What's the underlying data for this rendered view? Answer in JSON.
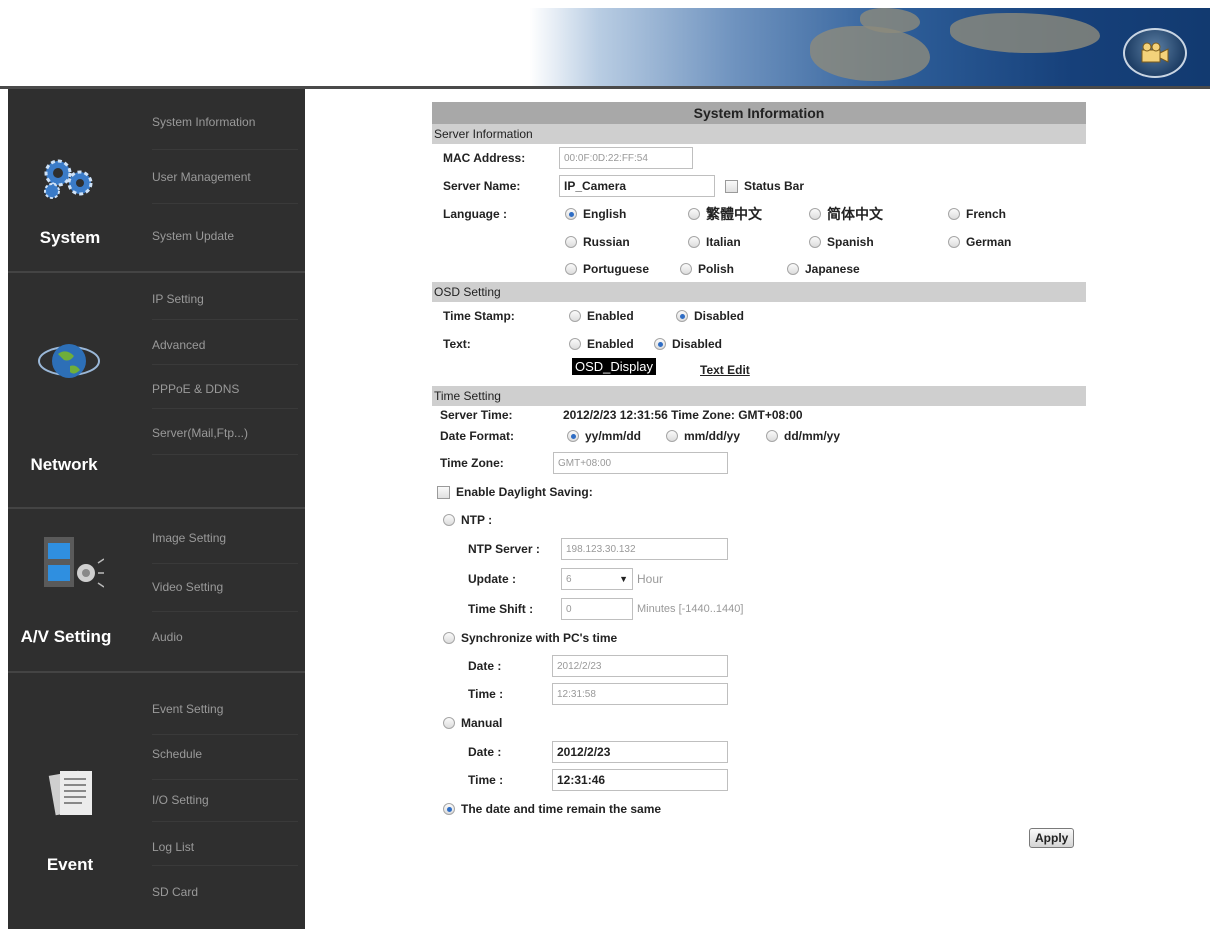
{
  "colors": {
    "sidebar_bg": "#2f2f2f",
    "title_bar": "#a8a8a8",
    "section_bar": "#cfcfcf",
    "radio_selected": "#2f6dc4"
  },
  "sidebar": {
    "sections": [
      {
        "label": "System",
        "icon": "gears-icon",
        "items": [
          "System Information",
          "User Management",
          "System Update"
        ]
      },
      {
        "label": "Network",
        "icon": "globe-icon",
        "items": [
          "IP Setting",
          "Advanced",
          "PPPoE & DDNS",
          "Server(Mail,Ftp...)"
        ]
      },
      {
        "label": "A/V Setting",
        "icon": "film-speaker-icon",
        "items": [
          "Image Setting",
          "Video Setting",
          "Audio"
        ]
      },
      {
        "label": "Event",
        "icon": "documents-icon",
        "items": [
          "Event Setting",
          "Schedule",
          "I/O Setting",
          "Log List",
          "SD Card"
        ]
      }
    ]
  },
  "panel": {
    "title": "System Information",
    "server": {
      "heading": "Server Information",
      "mac_label": "MAC Address:",
      "mac_value": "00:0F:0D:22:FF:54",
      "name_label": "Server Name:",
      "name_value": "IP_Camera",
      "status_bar_label": "Status Bar",
      "language_label": "Language :",
      "languages": [
        "English",
        "繁體中文",
        "简体中文",
        "French",
        "Russian",
        "Italian",
        "Spanish",
        "German",
        "Portuguese",
        "Polish",
        "Japanese"
      ],
      "selected_language": "English"
    },
    "osd": {
      "heading": "OSD Setting",
      "timestamp_label": "Time Stamp:",
      "text_label": "Text:",
      "enabled": "Enabled",
      "disabled": "Disabled",
      "timestamp_selected": "Disabled",
      "text_selected": "Disabled",
      "display_text": "OSD_Display",
      "text_edit": "Text Edit"
    },
    "time": {
      "heading": "Time Setting",
      "server_time_label": "Server Time:",
      "server_time_value": "2012/2/23 12:31:56 Time Zone: GMT+08:00",
      "date_format_label": "Date Format:",
      "formats": [
        "yy/mm/dd",
        "mm/dd/yy",
        "dd/mm/yy"
      ],
      "format_selected": "yy/mm/dd",
      "timezone_label": "Time Zone:",
      "timezone_value": "GMT+08:00",
      "daylight_label": "Enable Daylight Saving:",
      "ntp_label": "NTP :",
      "ntp_server_label": "NTP Server :",
      "ntp_server_value": "198.123.30.132",
      "update_label": "Update :",
      "update_value": "6",
      "update_unit": "Hour",
      "shift_label": "Time Shift :",
      "shift_value": "0",
      "shift_unit": "Minutes  [-1440..1440]",
      "sync_label": "Synchronize with PC's time",
      "sync_date_label": "Date :",
      "sync_date_value": "2012/2/23",
      "sync_time_label": "Time :",
      "sync_time_value": "12:31:58",
      "manual_label": "Manual",
      "manual_date_label": "Date :",
      "manual_date_value": "2012/2/23",
      "manual_time_label": "Time :",
      "manual_time_value": "12:31:46",
      "same_label": "The date and time remain the same",
      "time_mode_selected": "same"
    },
    "apply_label": "Apply"
  }
}
